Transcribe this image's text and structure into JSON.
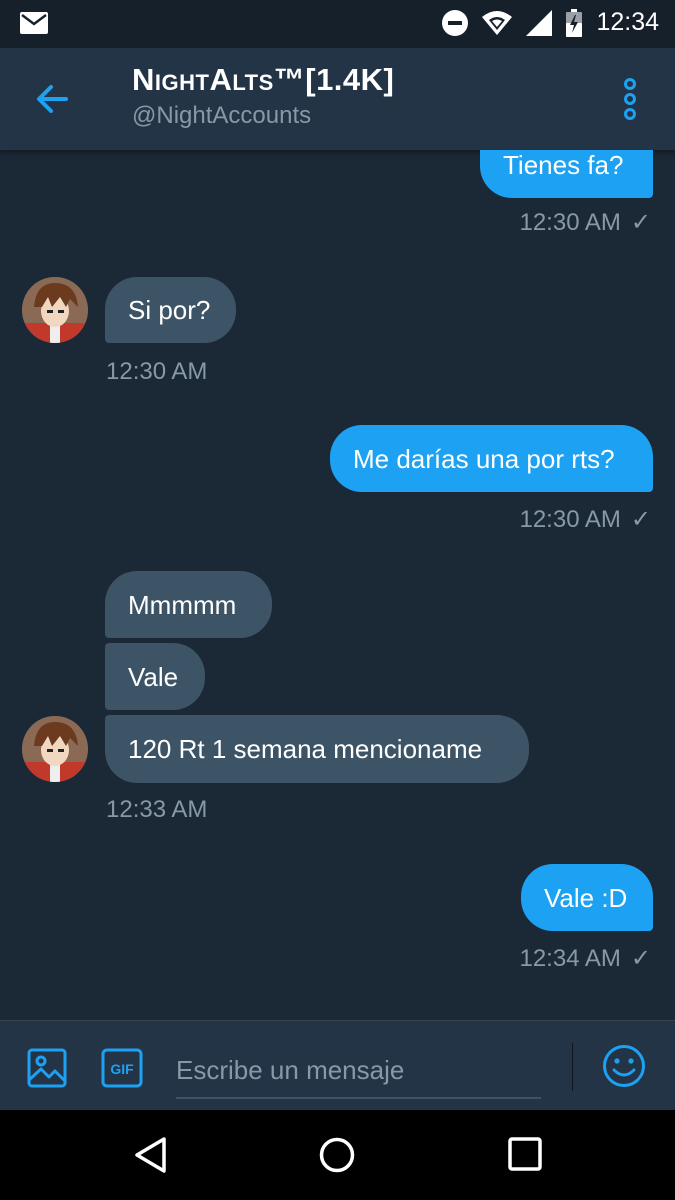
{
  "status_bar": {
    "time": "12:34"
  },
  "header": {
    "title": "NightAlts™[1.4K]",
    "handle": "@NightAccounts"
  },
  "messages": [
    {
      "direction": "outgoing",
      "text": "Tienes fa?",
      "time": "12:30 AM",
      "read": true
    },
    {
      "direction": "incoming",
      "text": "Si por?",
      "time": "12:30 AM"
    },
    {
      "direction": "outgoing",
      "text": "Me darías una por rts?",
      "time": "12:30 AM",
      "read": true
    },
    {
      "direction": "incoming",
      "text": "Mmmmm"
    },
    {
      "direction": "incoming",
      "text": "Vale"
    },
    {
      "direction": "incoming",
      "text": "120 Rt 1 semana mencioname",
      "time": "12:33 AM"
    },
    {
      "direction": "outgoing",
      "text": "Vale :D",
      "time": "12:34 AM",
      "read": true
    }
  ],
  "composer": {
    "placeholder": "Escribe un mensaje",
    "gif_label": "GIF"
  },
  "colors": {
    "background": "#1b2836",
    "header": "#243447",
    "outgoing_bubble": "#1da1f2",
    "incoming_bubble": "#3d5466",
    "accent": "#1da1f2",
    "muted_text": "#8899a6"
  },
  "icons": [
    "mail-icon",
    "dnd-icon",
    "wifi-icon",
    "signal-icon",
    "battery-icon",
    "back-arrow-icon",
    "more-vertical-icon",
    "image-icon",
    "gif-icon",
    "emoji-icon",
    "nav-back-icon",
    "nav-home-icon",
    "nav-recents-icon"
  ]
}
